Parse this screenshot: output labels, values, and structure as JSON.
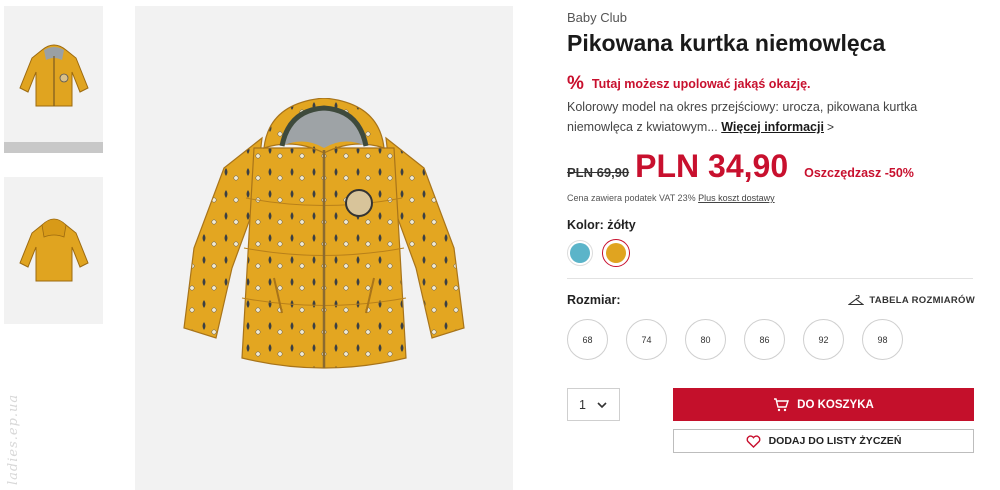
{
  "thumbnails": [
    {
      "alt": "jacket-front-thumbnail"
    },
    {
      "alt": "jacket-back-thumbnail"
    }
  ],
  "watermark": "ladies.ep.ua",
  "product": {
    "brand": "Baby Club",
    "title": "Pikowana kurtka niemowlęca",
    "promo_icon": "%",
    "promo_text": "Tutaj możesz upolować jakąś okazję.",
    "description": "Kolorowy model na okres przejściowy: urocza, pikowana kurtka niemowlęca z kwiatowym...",
    "more_info_label": "Więcej informacji",
    "more_info_chevron": ">",
    "old_price": "PLN 69,90",
    "new_price": "PLN 34,90",
    "savings": "Oszczędzasz -50%",
    "vat_note": "Cena zawiera podatek VAT 23%",
    "shipping_link": "Plus koszt dostawy",
    "color_label": "Kolor: żółty",
    "colors": [
      {
        "name": "blue",
        "hex": "#5bb4c9",
        "selected": false
      },
      {
        "name": "żółty",
        "hex": "#e0a420",
        "selected": true
      }
    ],
    "size_label": "Rozmiar:",
    "size_chart_label": "TABELA ROZMIARÓW",
    "sizes": [
      "68",
      "74",
      "80",
      "86",
      "92",
      "98"
    ],
    "quantity": "1",
    "add_to_cart_label": "DO KOSZYKA",
    "add_to_wishlist_label": "DODAJ DO LISTY ŻYCZEŃ"
  },
  "colors": {
    "accent_red": "#c8102e",
    "jacket_yellow": "#e0a420"
  }
}
